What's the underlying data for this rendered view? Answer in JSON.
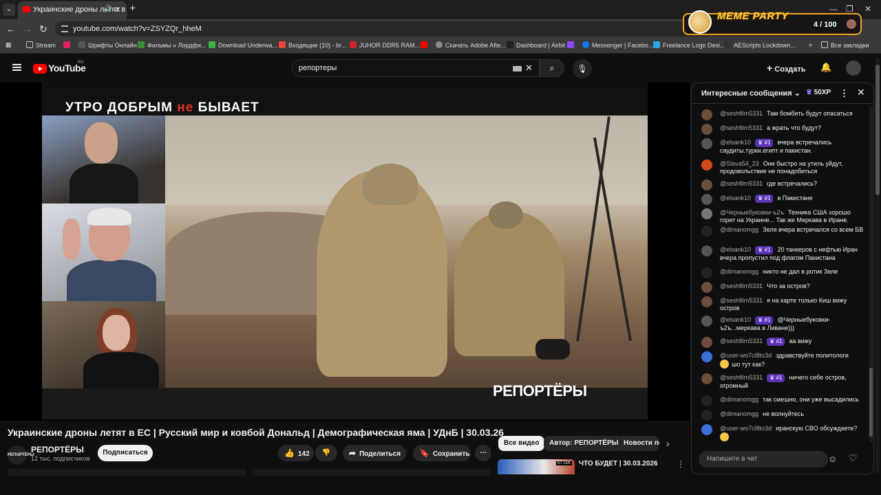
{
  "browser": {
    "tab_title": "Украинские дроны летят в",
    "url": "youtube.com/watch?v=ZSYZQr_hheM",
    "bookmarks": [
      "Stream",
      "Шрифты Онлайн",
      "Фильмы » Лордфи...",
      "Download Underwa...",
      "Входящие (10) - br...",
      "JUHOR DDR5 RAM...",
      "Скачать Adobe Afte...",
      "Dashboard | Airbit",
      "Messenger | Facebo...",
      "Freelance Logo Desi...",
      "AEScripts Lockdown...",
      "Все закладки"
    ]
  },
  "extension": {
    "name": "MEME PARTY",
    "count": "4 / 100"
  },
  "youtube": {
    "logo": "YouTube",
    "region": "RU",
    "search_value": "репортеры",
    "create_label": "Создать"
  },
  "video": {
    "banner_pre": "УТРО ДОБРЫМ ",
    "banner_hl": "не",
    "banner_post": " БЫВАЕТ",
    "watermark": "РЕПОРТЁРЫ",
    "title": "Украинские дроны летят в ЕС | Русский мир и ковбой Дональд | Демографическая яма | УДнБ | 30.03.26",
    "channel": "РЕПОРТЁРЫ",
    "channel_avatar_text": "РЕПОРТЁРЫ",
    "subs": "12 тыс. подписчиков",
    "subscribe": "Подписаться",
    "likes": "142",
    "share": "Поделиться",
    "save": "Сохранить"
  },
  "recommendations": {
    "chips": [
      "Все видео",
      "Автор: РЕПОРТЁРЫ",
      "Новости по"
    ],
    "first_title": "ЧТО БУДЕТ | 30.03.2026",
    "first_views": "57.21K"
  },
  "chat": {
    "header": "Интересные сообщения",
    "xp": "50XP",
    "placeholder": "Напишите в чат",
    "messages": [
      {
        "user": "@seshfilm5331",
        "badge": "",
        "text": "Там бомбить будут опасаться",
        "av": "#6b4d3c"
      },
      {
        "user": "@seshfilm5331",
        "badge": "",
        "text": "а жрать что будут?",
        "av": "#6b4d3c"
      },
      {
        "user": "@elsank10",
        "badge": "#1",
        "text": "вчера встречались саудиты.турки.египт и пакистан.",
        "av": "#555"
      },
      {
        "user": "@Slava54_23",
        "badge": "",
        "text": "Они быстро на утиль уйдут, продовольствие не понадобиться",
        "av": "#d24a1e"
      },
      {
        "user": "@seshfilm5331",
        "badge": "",
        "text": "где встречались?",
        "av": "#6b4d3c"
      },
      {
        "user": "@elsank10",
        "badge": "#1",
        "text": "в Пакистане",
        "av": "#555"
      },
      {
        "user": "@Черныебуковки-ъ2ъ",
        "badge": "",
        "text": "Техника США хорошо горит на Украине... Так же Меркава в Иране.",
        "av": "#777"
      },
      {
        "user": "@dimanomgg",
        "badge": "",
        "text": "Зеля вчера встречался со всем БВ",
        "av": "#222"
      },
      {
        "user": "@elsank10",
        "badge": "#1",
        "text": "20 танкеров с нефтью Иран вчера пропустил под флагом Пакистана",
        "av": "#555"
      },
      {
        "user": "@dimanomgg",
        "badge": "",
        "text": "никто не дал в ротик Зеле",
        "av": "#222"
      },
      {
        "user": "@seshfilm5331",
        "badge": "",
        "text": "Что за остров?",
        "av": "#6b4d3c"
      },
      {
        "user": "@seshfilm5331",
        "badge": "",
        "text": "я на карте только Киш вижу остров",
        "av": "#6b4d3c"
      },
      {
        "user": "@elsank10",
        "badge": "#1",
        "text": "@Черныебуковки-ъ2ъ...меркава в Ливане)))",
        "av": "#555"
      },
      {
        "user": "@seshfilm5331",
        "badge": "#1",
        "text": "аа вижу",
        "av": "#6b4d3c"
      },
      {
        "user": "@user-wo7cl8to3d",
        "badge": "",
        "text": "здравствуйте политологи",
        "emoji": "шо тут как?",
        "av": "#3b6fd8"
      },
      {
        "user": "@seshfilm5331",
        "badge": "#1",
        "text": "ничего себе остров, огромный",
        "av": "#6b4d3c"
      },
      {
        "user": "@dimanomgg",
        "badge": "",
        "text": "так смешно, они уже высадились",
        "av": "#222"
      },
      {
        "user": "@dimanomgg",
        "badge": "",
        "text": "не волнуйтесь",
        "av": "#222"
      },
      {
        "user": "@user-wo7cl8to3d",
        "badge": "",
        "text": "иранскую СВО обсуждаете?",
        "emoji": "",
        "av": "#3b6fd8"
      }
    ]
  }
}
